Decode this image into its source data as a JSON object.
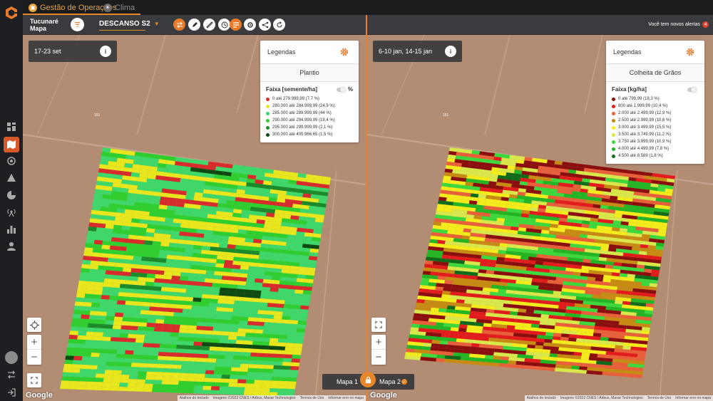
{
  "top_tabs": [
    {
      "label": "Gestão de Operações",
      "color": "#e8a33a"
    },
    {
      "label": "Clima",
      "color": "#8a8a8a"
    }
  ],
  "header": {
    "farm": "Tucunaré",
    "section": "Mapa",
    "season": "DESCANSO S2",
    "alerts_text": "Você tem novos alertas",
    "alerts_count": "4"
  },
  "map_left": {
    "date": "17-23 set",
    "legend_title": "Legendas",
    "operation": "Plantio",
    "range_label": "Faixa [semente/ha]",
    "percent_symbol": "%",
    "field_code": "151",
    "items": [
      {
        "label": "0 até 279.999,99 (7,7 %)",
        "color": "#d62c2c"
      },
      {
        "label": "280.000 até 284.999,99 (24,9 %)",
        "color": "#e8e61c"
      },
      {
        "label": "285.000 até 289.999,99 (44 %)",
        "color": "#3ed86a"
      },
      {
        "label": "290.000 até 294.999,99 (19,4 %)",
        "color": "#2fcf2f"
      },
      {
        "label": "295.000 até 299.999,99 (2,1 %)",
        "color": "#1a8a2a"
      },
      {
        "label": "300.000 até 405.966,65 (1,5 %)",
        "color": "#0d4a12"
      }
    ]
  },
  "map_right": {
    "date": "6-10 jan, 14-15 jan",
    "legend_title": "Legendas",
    "operation": "Colheita de Grãos",
    "range_label": "Faixa [kg/ha]",
    "field_code": "151",
    "items": [
      {
        "label": "0 até 799,99 (18,3 %)",
        "color": "#8a0e0e"
      },
      {
        "label": "800 até 1.999,99 (10,4 %)",
        "color": "#e21c1c"
      },
      {
        "label": "2.000 até 2.499,99 (12,9 %)",
        "color": "#e8603a"
      },
      {
        "label": "2.500 até 2.999,99 (10,6 %)",
        "color": "#c78a12"
      },
      {
        "label": "3.000 até 3.499,99 (15,5 %)",
        "color": "#f4ec1a"
      },
      {
        "label": "3.500 até 3.749,99 (11,2 %)",
        "color": "#d8e84a"
      },
      {
        "label": "3.750 até 3.999,99 (10,9 %)",
        "color": "#3cd83c"
      },
      {
        "label": "4.000 até 4.499,99 (7,8 %)",
        "color": "#23b523"
      },
      {
        "label": "4.500 até 8.589 (1,8 %)",
        "color": "#0f6a1a"
      }
    ]
  },
  "map_common": {
    "google": "Google",
    "attrib": [
      "Atalhos do teclado",
      "Imagens ©2022 CNES / Airbus, Maxar Technologies",
      "Termos de Uso",
      "Informar erro no mapa"
    ]
  },
  "map_switch": {
    "map1": "Mapa 1",
    "map2": "Mapa 2"
  }
}
